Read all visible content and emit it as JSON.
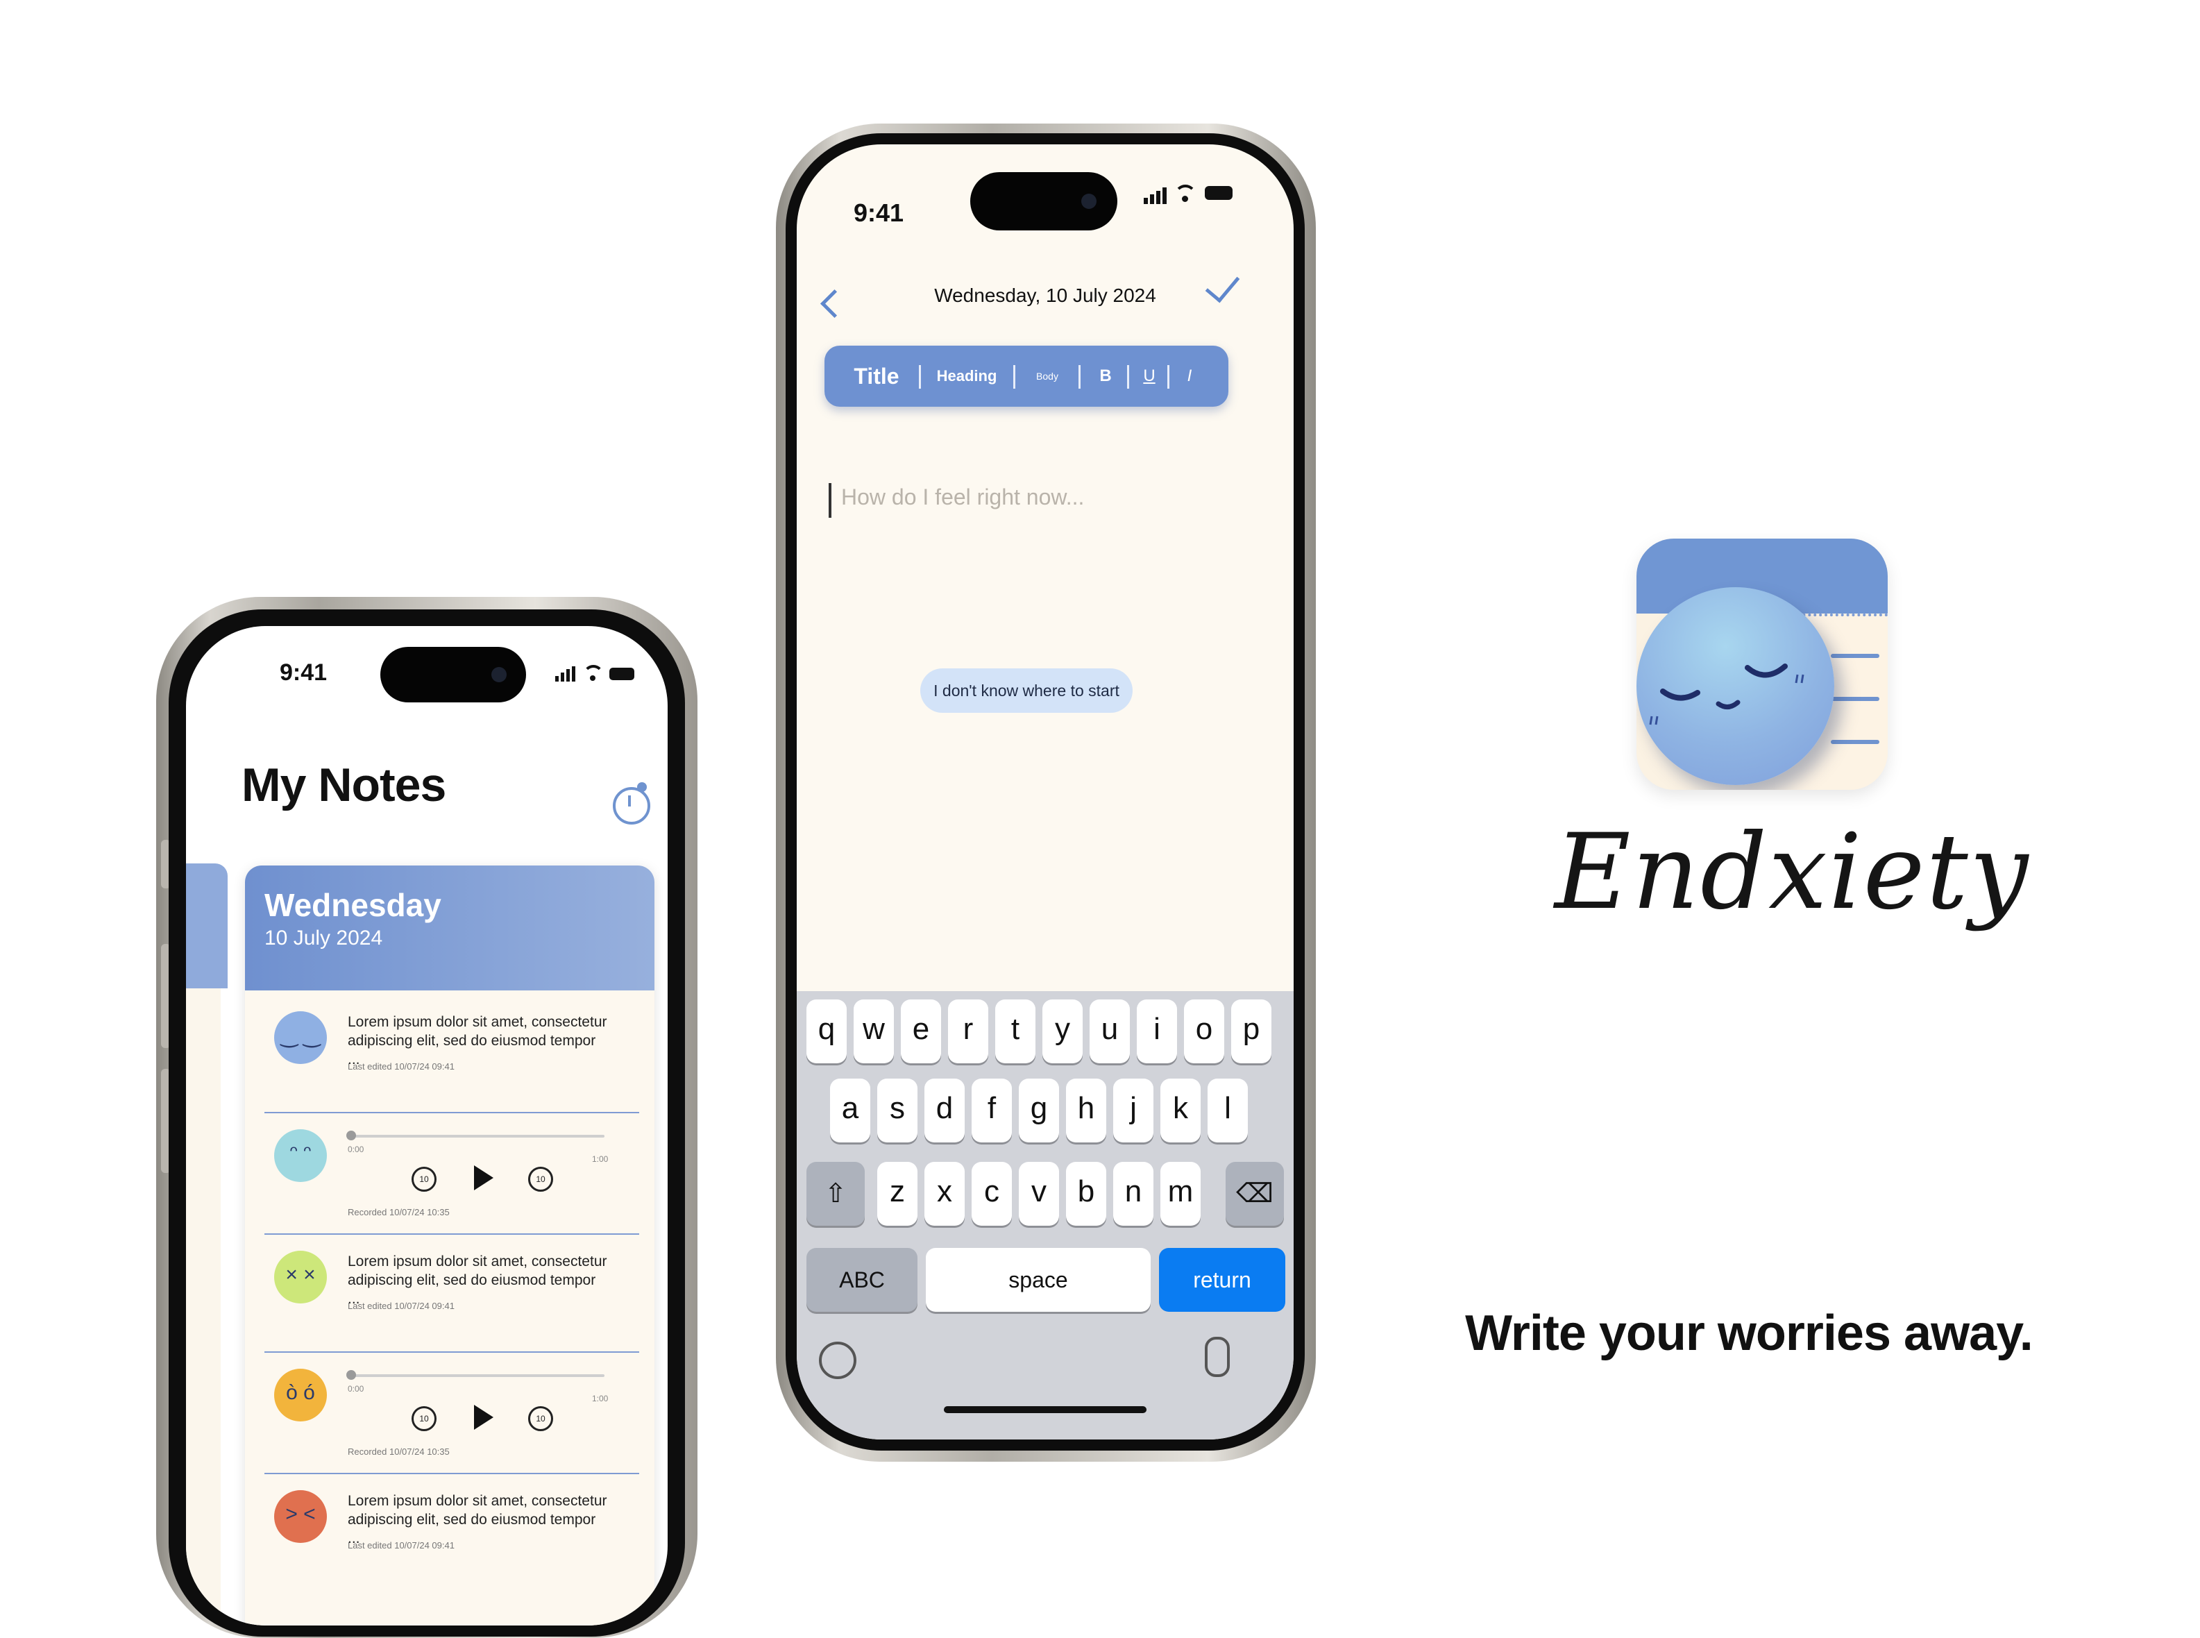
{
  "status_bar": {
    "time": "9:41"
  },
  "notes_screen": {
    "title": "My Notes",
    "day_card": {
      "weekday": "Wednesday",
      "date": "10 July 2024"
    },
    "entries": [
      {
        "kind": "text",
        "mood": "calm",
        "mood_color": "#8fb0e3",
        "text": "Lorem ipsum dolor sit amet, consectetur adipiscing elit, sed do eiusmod tempor ...",
        "meta": "Last edited 10/07/24 09:41"
      },
      {
        "kind": "audio",
        "mood": "sad",
        "mood_color": "#9ed8e0",
        "start": "0:00",
        "end": "1:00",
        "skip_back": "10",
        "skip_forward": "10",
        "meta": "Recorded 10/07/24 10:35"
      },
      {
        "kind": "text",
        "mood": "sick",
        "mood_color": "#cde77a",
        "text": "Lorem ipsum dolor sit amet, consectetur adipiscing elit, sed do eiusmod tempor ...",
        "meta": "Last edited 10/07/24 09:41"
      },
      {
        "kind": "audio",
        "mood": "anxious",
        "mood_color": "#f2b43c",
        "start": "0:00",
        "end": "1:00",
        "skip_back": "10",
        "skip_forward": "10",
        "meta": "Recorded 10/07/24 10:35"
      },
      {
        "kind": "text",
        "mood": "angry",
        "mood_color": "#e0704f",
        "text": "Lorem ipsum dolor sit amet, consectetur adipiscing elit, sed do eiusmod tempor ...",
        "meta": "Last edited 10/07/24 09:41"
      }
    ]
  },
  "editor_screen": {
    "date_title": "Wednesday, 10 July 2024",
    "format_bar": {
      "title": "Title",
      "heading": "Heading",
      "body": "Body",
      "bold": "B",
      "underline": "U",
      "italic": "I"
    },
    "placeholder": "How do I feel right now...",
    "prompt_chip": "I don't know where to start",
    "keyboard": {
      "row1": [
        "q",
        "w",
        "e",
        "r",
        "t",
        "y",
        "u",
        "i",
        "o",
        "p"
      ],
      "row2": [
        "a",
        "s",
        "d",
        "f",
        "g",
        "h",
        "j",
        "k",
        "l"
      ],
      "row3": [
        "z",
        "x",
        "c",
        "v",
        "b",
        "n",
        "m"
      ],
      "abc": "ABC",
      "space": "space",
      "return": "return"
    },
    "accent_color": "#6e91d1"
  },
  "brand": {
    "name": "Endxiety",
    "tagline": "Write your worries away."
  },
  "icons": [
    "back-icon",
    "check-icon",
    "history-icon",
    "shift-icon",
    "delete-icon",
    "emoji-icon",
    "mic-icon",
    "play-icon",
    "skip-back-icon",
    "skip-forward-icon",
    "signal-icon",
    "wifi-icon",
    "battery-icon"
  ]
}
